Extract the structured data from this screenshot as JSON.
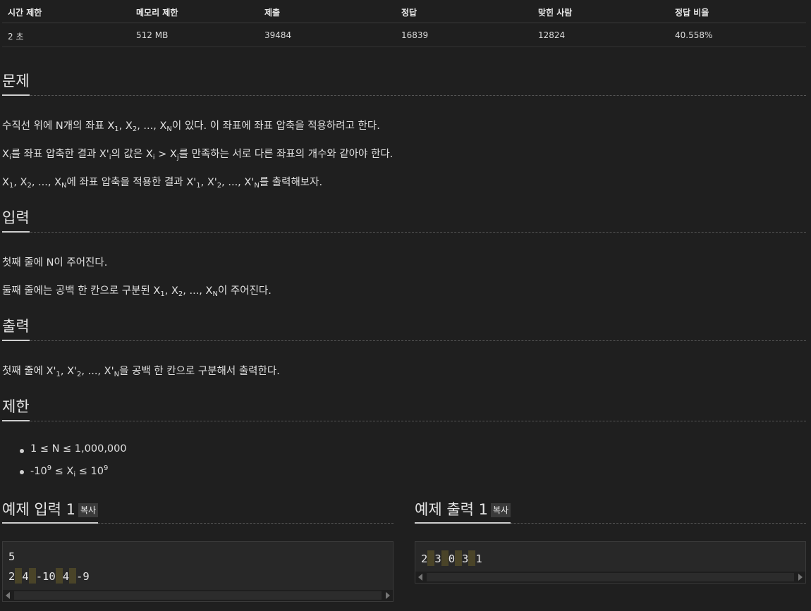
{
  "stats": {
    "headers": [
      "시간 제한",
      "메모리 제한",
      "제출",
      "정답",
      "맞힌 사람",
      "정답 비율"
    ],
    "values": [
      "2 초",
      "512 MB",
      "39484",
      "16839",
      "12824",
      "40.558%"
    ]
  },
  "sections": {
    "problem": {
      "title": "문제",
      "p1_a": "수직선 위에 N개의 좌표 X",
      "p1_b": "이 있다. 이 좌표에 좌표 압축을 적용하려고 한다.",
      "p2_a": "를 좌표 압축한 결과 X'",
      "p2_b": "의 값은 X",
      "p2_c": " > X",
      "p2_d": "를 만족하는 서로 다른 좌표의 개수와 같아야 한다.",
      "p3_a": "에 좌표 압축을 적용한 결과 X'",
      "p3_b": "를 출력해보자."
    },
    "input": {
      "title": "입력",
      "p1": "첫째 줄에 N이 주어진다.",
      "p2_a": "둘째 줄에는 공백 한 칸으로 구분된 X",
      "p2_b": "이 주어진다."
    },
    "output": {
      "title": "출력",
      "p1_a": "첫째 줄에 X'",
      "p1_b": "을 공백 한 칸으로 구분해서 출력한다."
    },
    "limits": {
      "title": "제한",
      "item1": "1 ≤ N ≤ 1,000,000",
      "item2_a": "-10",
      "item2_b": " ≤ X",
      "item2_c": " ≤ 10"
    }
  },
  "examples": {
    "input_title": "예제 입력 1",
    "output_title": "예제 출력 1",
    "copy_label": "복사",
    "input_line1": "5",
    "input_tokens": [
      "2",
      "4",
      "-10",
      "4",
      "-9"
    ],
    "output_tokens": [
      "2",
      "3",
      "0",
      "3",
      "1"
    ]
  }
}
